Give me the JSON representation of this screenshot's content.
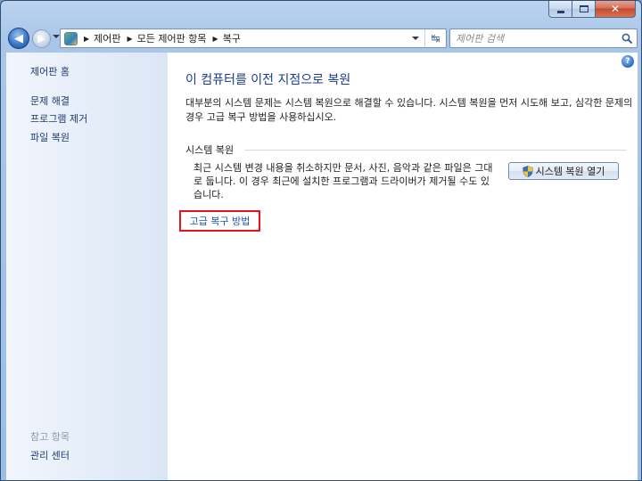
{
  "window": {
    "minimize_glyph": "",
    "close_glyph": "✕"
  },
  "nav": {
    "back_glyph": "◀",
    "forward_glyph": "▶",
    "breadcrumbs": [
      "제어판",
      "모든 제어판 항목",
      "복구"
    ],
    "separator": "▶",
    "refresh_glyph": "↹",
    "search_placeholder": "제어판 검색"
  },
  "sidebar": {
    "home": "제어판 홈",
    "links": [
      "문제 해결",
      "프로그램 제거",
      "파일 복원"
    ],
    "see_also_heading": "참고 항목",
    "see_also_links": [
      "관리 센터"
    ]
  },
  "main": {
    "help_glyph": "?",
    "title": "이 컴퓨터를 이전 지점으로 복원",
    "intro": "대부분의 시스템 문제는 시스템 복원으로 해결할 수 있습니다. 시스템 복원을 먼저 시도해 보고, 심각한 문제의 경우 고급 복구 방법을 사용하십시오.",
    "section_title": "시스템 복원",
    "section_desc": "최근 시스템 변경 내용을 취소하지만 문서, 사진, 음악과 같은 파일은 그대로 둡니다. 이 경우 최근에 설치한 프로그램과 드라이버가 제거될 수도 있습니다.",
    "restore_button": "시스템 복원 열기",
    "advanced_link": "고급 복구 방법"
  },
  "colors": {
    "accent_link": "#1a54b8",
    "title_blue": "#1a3d8f",
    "highlight_red": "#e8141d"
  }
}
